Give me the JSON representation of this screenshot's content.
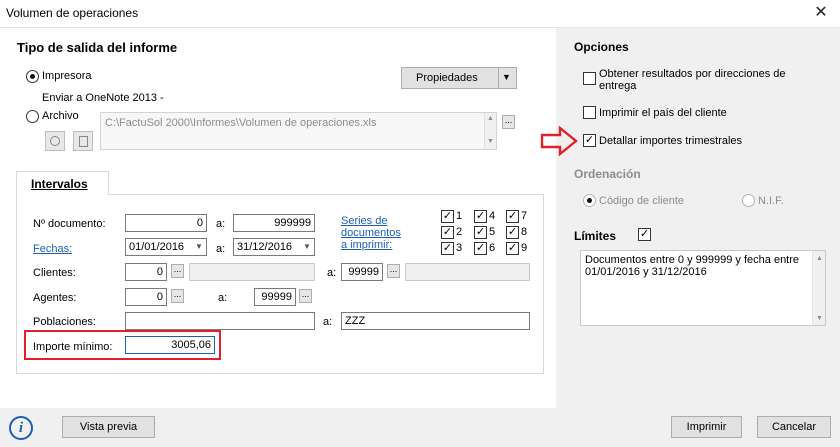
{
  "window": {
    "title": "Volumen de operaciones",
    "close": "✕"
  },
  "output": {
    "heading": "Tipo de salida del informe",
    "printer_label": "Impresora",
    "printer_name": "Enviar a OneNote 2013 -",
    "properties_label": "Propiedades",
    "file_label": "Archivo",
    "file_path": "C:\\FactuSol 2000\\Informes\\Volumen de operaciones.xls",
    "browse_label": "..."
  },
  "intervals": {
    "tab_label": "Intervalos",
    "doc_label": "Nº documento:",
    "doc_from": "0",
    "doc_to": "999999",
    "to_label": "a:",
    "dates_label": "Fechas:",
    "date_from": "01/01/2016",
    "date_to": "31/12/2016",
    "series_link": [
      "Series de",
      "documentos",
      "a imprimir:"
    ],
    "series": [
      "1",
      "2",
      "3",
      "4",
      "5",
      "6",
      "7",
      "8",
      "9"
    ],
    "clients_label": "Clientes:",
    "client_from": "0",
    "client_to": "99999",
    "agents_label": "Agentes:",
    "agent_from": "0",
    "agent_to": "99999",
    "towns_label": "Poblaciones:",
    "town_from": "",
    "town_to": "ZZZ",
    "min_amount_label": "Importe mínimo:",
    "min_amount": "3005,06"
  },
  "options": {
    "heading": "Opciones",
    "opt1": [
      "Obtener resultados por direcciones de",
      "entrega"
    ],
    "opt2": "Imprimir el país del cliente",
    "opt3": "Detallar importes trimestrales",
    "order_heading": "Ordenación",
    "order_client": "Código de cliente",
    "order_nif": "N.I.F.",
    "limits_heading": "Límites",
    "limits_text": [
      "Documentos entre 0 y 999999 y fecha entre",
      "01/01/2016 y 31/12/2016"
    ]
  },
  "footer": {
    "info_icon": "i",
    "preview": "Vista previa",
    "print": "Imprimir",
    "cancel": "Cancelar"
  },
  "colors": {
    "highlight": "#e0202a",
    "link": "#1a5fb4",
    "panel": "#f0f0f0"
  }
}
